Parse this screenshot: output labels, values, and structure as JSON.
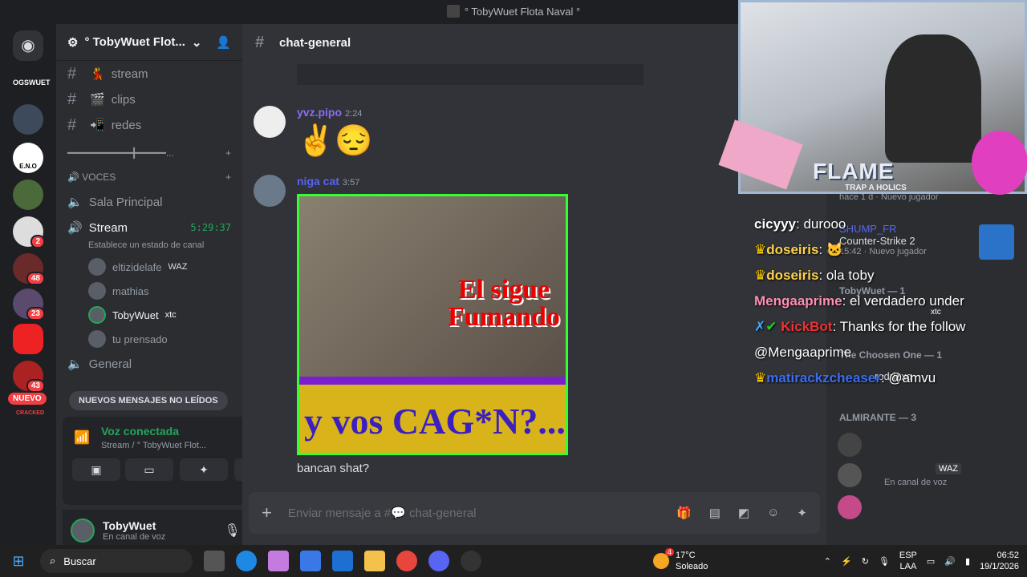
{
  "title": "° TobyWuet Flota Naval °",
  "server": {
    "name": "° TobyWuet Flot...",
    "channels": [
      {
        "name": "stream",
        "emoji": "💃"
      },
      {
        "name": "clips",
        "emoji": "🎬"
      },
      {
        "name": "redes",
        "emoji": "📲"
      }
    ],
    "separator": "━━━━━━━━━━━╋━━━━━...",
    "voice_category": "VOCES",
    "voice_channels": [
      "Sala Principal",
      "Stream",
      "General"
    ],
    "stream_timer": "5:29:37",
    "stream_status": "Establece un estado de canal",
    "voice_users": [
      {
        "name": "eltizidelafe",
        "tag": "WAZ"
      },
      {
        "name": "mathias",
        "tag": ""
      },
      {
        "name": "TobyWuet",
        "tag": "xtc"
      },
      {
        "name": "tu prensado",
        "tag": ""
      }
    ],
    "new_messages": "NUEVOS MENSAJES NO LEÍDOS"
  },
  "guild_badges": [
    "2",
    "48",
    "23",
    "43"
  ],
  "guild_labels": {
    "ogswuet": "OGSWUET",
    "eno": "E.N.O",
    "nuevo": "NUEVO",
    "cracked": "CRACKED"
  },
  "voice_panel": {
    "status": "Voz conectada",
    "location": "Stream / ° TobyWuet Flot..."
  },
  "user_panel": {
    "name": "TobyWuet",
    "status": "En canal de voz"
  },
  "channel": {
    "name": "chat-general"
  },
  "messages": [
    {
      "author": "yvz.pipo",
      "time": "2:24",
      "content": "✌️😔",
      "color": "#8b6df2"
    },
    {
      "author": "niga cat",
      "time": "3:57",
      "content": "",
      "color": "#5865f2"
    }
  ],
  "meme": {
    "top": "El sigue Fumando",
    "bottom": "y vos CAG*N?..."
  },
  "after_image": "bancan shat?",
  "composer": {
    "placeholder": "Enviar mensaje a #💬 chat-general"
  },
  "members": {
    "games": [
      {
        "time": "hace 1 d",
        "label": "Nuevo jugador"
      },
      {
        "name": "SHUMP_FR",
        "game": "Counter-Strike 2",
        "time": "15:42",
        "label": "Nuevo jugador"
      }
    ],
    "groups": [
      {
        "title": "TobyWuet — 1",
        "tag": "xtc"
      },
      {
        "title": "The Choosen One — 1",
        "user": "rodriexq"
      },
      {
        "title": "ALMIRANTE — 3",
        "tag": "WAZ",
        "status": "En canal de voz"
      }
    ]
  },
  "overlay": {
    "flame": "FLAME",
    "sub": "TRAP A HOLICS",
    "chat": [
      {
        "user": "cicyyy",
        "text": "durooo",
        "color": "#ffffff"
      },
      {
        "user": "doseiris",
        "text": "🐱",
        "color": "#ffd24a"
      },
      {
        "user": "doseiris",
        "text": "ola toby",
        "color": "#ffd24a"
      },
      {
        "user": "Mengaaprime",
        "text": "el verdadero under",
        "color": "#ff8fb0"
      },
      {
        "user": "KickBot",
        "text": "Thanks for the follow @Mengaaprime",
        "color": "#e33"
      },
      {
        "user": "matirackzcheaser",
        "text": "@amvu",
        "color": "#3a6df0"
      }
    ]
  },
  "taskbar": {
    "search": "Buscar",
    "weather_temp": "17°C",
    "weather": "Soleado",
    "lang": "ESP",
    "layout": "LAA",
    "time": "06:52",
    "date": "19/1/2026",
    "weather_badge": "4"
  }
}
